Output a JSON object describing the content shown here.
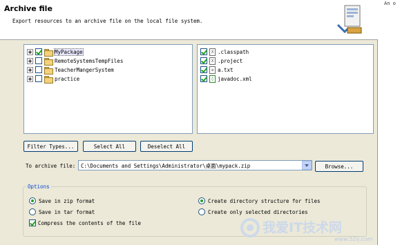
{
  "banner": {
    "title": "Archive file",
    "description": "Export resources to an archive file on the local file system."
  },
  "side_text": "An o",
  "projects": [
    {
      "label": "MyPackage",
      "checked": true
    },
    {
      "label": "RemoteSystemsTempFiles",
      "checked": false
    },
    {
      "label": "TeacherMangerSystem",
      "checked": false
    },
    {
      "label": "practice",
      "checked": false
    }
  ],
  "files": [
    {
      "label": ".classpath",
      "checked": true,
      "icon": "x-file-icon"
    },
    {
      "label": ".project",
      "checked": true,
      "icon": "x-file-icon"
    },
    {
      "label": "a.txt",
      "checked": true,
      "icon": "text-file-icon"
    },
    {
      "label": "javadoc.xml",
      "checked": true,
      "icon": "xml-file-icon"
    }
  ],
  "buttons": {
    "filter_types": "Filter Types...",
    "select_all": "Select All",
    "deselect_all": "Deselect All",
    "browse": "Browse..."
  },
  "archive": {
    "label": "To archive file:",
    "value": "C:\\Documents and Settings\\Administrator\\桌面\\mypack.zip"
  },
  "options": {
    "legend": "Options",
    "save_zip": "Save in zip format",
    "save_tar": "Save in tar format",
    "compress": "Compress the contents of the file",
    "create_dir_structure": "Create directory structure for files",
    "create_selected_dirs": "Create only selected directories"
  },
  "watermark": {
    "text": "我爱IT技术网",
    "url": "www.52ij.com"
  }
}
